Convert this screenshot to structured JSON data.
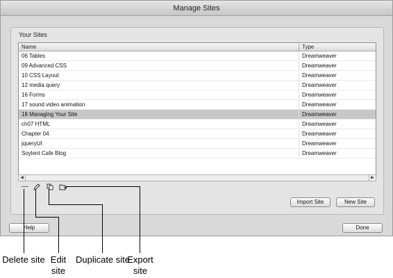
{
  "window": {
    "title": "Manage Sites"
  },
  "panel": {
    "label": "Your Sites"
  },
  "table": {
    "columns": [
      "Name",
      "Type"
    ],
    "rows": [
      {
        "name": "06 Tables",
        "type": "Dreamweaver"
      },
      {
        "name": "09 Advanced CSS",
        "type": "Dreamweaver"
      },
      {
        "name": "10 CSS Layout",
        "type": "Dreamweaver"
      },
      {
        "name": "12 media query",
        "type": "Dreamweaver"
      },
      {
        "name": "16 Forms",
        "type": "Dreamweaver"
      },
      {
        "name": "17 sound video animation",
        "type": "Dreamweaver"
      },
      {
        "name": "18 Managing Your Site",
        "type": "Dreamweaver",
        "selected": true
      },
      {
        "name": "ch07 HTML",
        "type": "Dreamweaver"
      },
      {
        "name": "Chapter 04",
        "type": "Dreamweaver"
      },
      {
        "name": "jqueryUI",
        "type": "Dreamweaver"
      },
      {
        "name": "Soylent Cafe Blog",
        "type": "Dreamweaver"
      }
    ]
  },
  "toolbar": {
    "delete_icon": "minus-icon",
    "edit_icon": "pencil-icon",
    "duplicate_icon": "duplicate-icon",
    "export_icon": "export-folder-icon"
  },
  "buttons": {
    "import_site": "Import Site",
    "new_site": "New Site",
    "help": "Help",
    "done": "Done"
  },
  "callouts": {
    "delete": "Delete site",
    "edit": "Edit site",
    "duplicate": "Duplicate site",
    "export": "Export site"
  }
}
